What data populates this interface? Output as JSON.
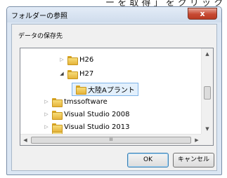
{
  "caption": {
    "cut_text": "ー を 取 得 」 を ク リ ッ ク"
  },
  "dialog": {
    "title": "フォルダーの参照",
    "close_label": "x",
    "description": "データの保存先"
  },
  "tree": {
    "items": [
      {
        "label": "H26",
        "arrow": "▷"
      },
      {
        "label": "H27",
        "arrow": "◢"
      },
      {
        "label": "大陸Aプラント",
        "arrow": ""
      },
      {
        "label": "tmssoftware",
        "arrow": "▷"
      },
      {
        "label": "Visual Studio 2008",
        "arrow": "▷"
      },
      {
        "label": "Visual Studio 2013",
        "arrow": "▷"
      },
      {
        "label": "",
        "arrow": ""
      }
    ],
    "vscroll": {
      "up": "▲",
      "down": "▼"
    },
    "hscroll": {
      "left": "◀",
      "right": "▶",
      "grip": "III"
    }
  },
  "buttons": {
    "ok": "OK",
    "cancel": "キャンセル"
  }
}
